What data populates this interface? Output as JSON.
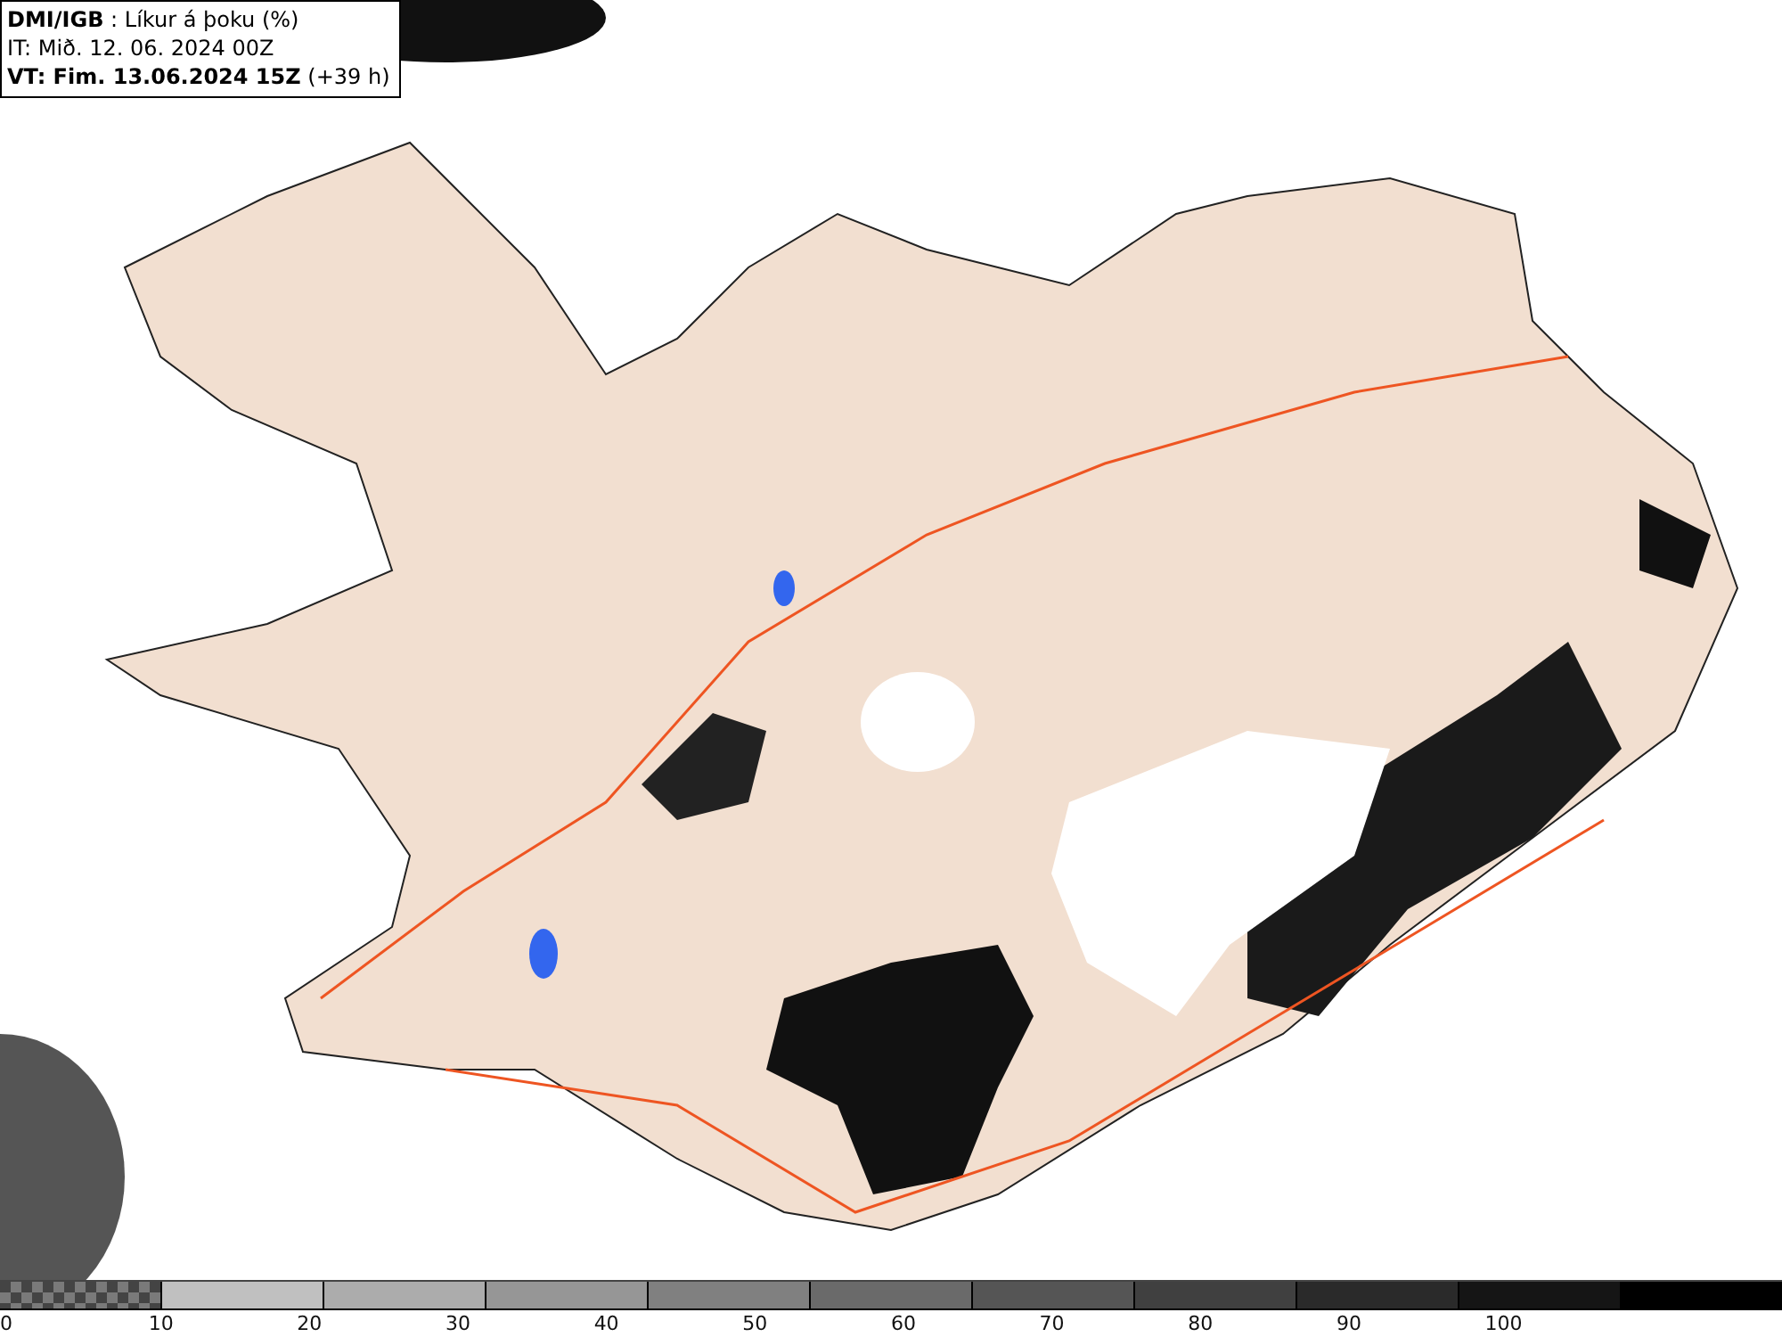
{
  "header": {
    "source": "DMI/IGB",
    "variable": ": Líkur á þoku (%)",
    "issue_time": "IT: Mið. 12. 06. 2024 00Z",
    "valid_time": "VT: Fim. 13.06.2024 15Z",
    "lead": "(+39 h)"
  },
  "legend": {
    "bins": [
      {
        "kind": "pattern",
        "color": "#7a7a7a"
      },
      {
        "kind": "solid",
        "color": "#c0c0c0"
      },
      {
        "kind": "solid",
        "color": "#acacac"
      },
      {
        "kind": "solid",
        "color": "#969696"
      },
      {
        "kind": "solid",
        "color": "#808080"
      },
      {
        "kind": "solid",
        "color": "#6a6a6a"
      },
      {
        "kind": "solid",
        "color": "#555555"
      },
      {
        "kind": "solid",
        "color": "#404040"
      },
      {
        "kind": "solid",
        "color": "#2a2a2a"
      },
      {
        "kind": "solid",
        "color": "#151515"
      },
      {
        "kind": "solid",
        "color": "#000000"
      }
    ],
    "ticks": [
      "0",
      "10",
      "20",
      "30",
      "40",
      "50",
      "60",
      "70",
      "80",
      "90",
      "100"
    ]
  }
}
